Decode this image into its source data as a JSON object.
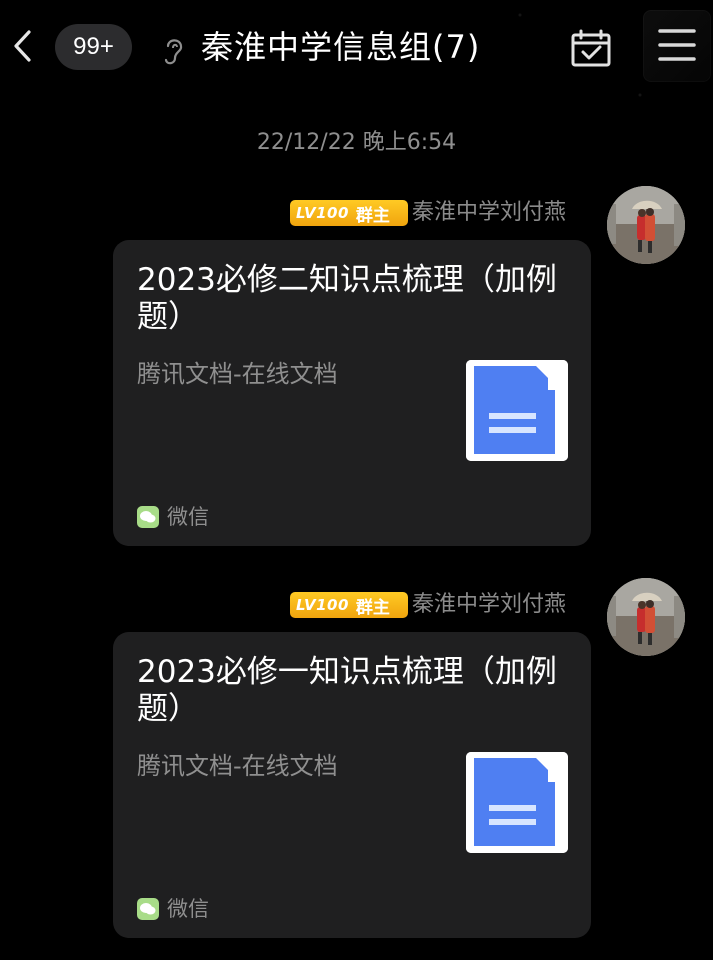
{
  "header": {
    "back_icon": "chevron-left-icon",
    "unread_count": "99+",
    "mode_icon": "ear-icon",
    "title": "秦淮中学信息组(7)",
    "calendar_icon": "calendar-check-icon",
    "menu_icon": "menu-icon"
  },
  "timestamp": "22/12/22 晚上6:54",
  "messages": [
    {
      "sender": {
        "level": "LV100",
        "role": "群主",
        "name": "秦淮中学刘付燕"
      },
      "card": {
        "title": "2023必修二知识点梳理（加例题）",
        "source": "腾讯文档-在线文档",
        "thumbnail_icon": "document-icon",
        "app_icon": "wechat-icon",
        "app_name": "微信"
      }
    },
    {
      "sender": {
        "level": "LV100",
        "role": "群主",
        "name": "秦淮中学刘付燕"
      },
      "card": {
        "title": "2023必修一知识点梳理（加例题）",
        "source": "腾讯文档-在线文档",
        "thumbnail_icon": "document-icon",
        "app_icon": "wechat-icon",
        "app_name": "微信"
      }
    }
  ],
  "colors": {
    "background": "#000000",
    "card": "#1f1f20",
    "muted_text": "#8f8f8f",
    "badge_gold": "#ffbf19",
    "doc_blue": "#4f7ff2",
    "wechat_green": "#a8dc88"
  }
}
